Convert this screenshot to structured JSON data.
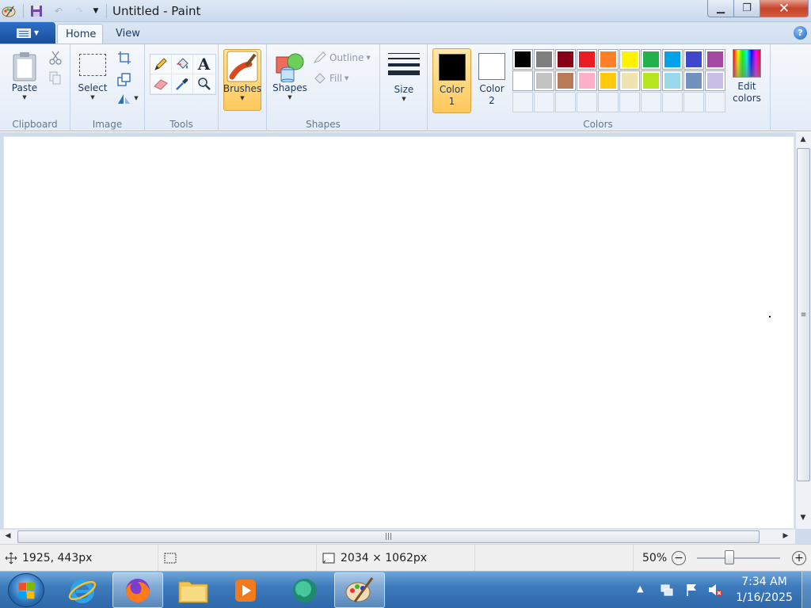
{
  "window": {
    "title": "Untitled - Paint",
    "controls": {
      "minimize": "▁",
      "maximize": "❐",
      "close": "✕"
    }
  },
  "quick_access": {
    "icons": [
      "paint-app-icon",
      "save-icon",
      "undo-icon",
      "redo-icon",
      "customize-arrow-icon"
    ]
  },
  "tabs": [
    {
      "label": "Home",
      "active": true
    },
    {
      "label": "View",
      "active": false
    }
  ],
  "ribbon": {
    "clipboard": {
      "group_label": "Clipboard",
      "paste_label": "Paste"
    },
    "image": {
      "group_label": "Image",
      "select_label": "Select"
    },
    "tools": {
      "group_label": "Tools"
    },
    "brushes": {
      "label": "Brushes"
    },
    "shapes": {
      "group_label": "Shapes",
      "shapes_label": "Shapes",
      "outline_label": "Outline",
      "fill_label": "Fill"
    },
    "size": {
      "label": "Size"
    },
    "colors": {
      "group_label": "Colors",
      "color1_label": "Color\n1",
      "color1_line1": "Color",
      "color1_line2": "1",
      "color2_line1": "Color",
      "color2_line2": "2",
      "color1_value": "#000000",
      "color2_value": "#ffffff",
      "edit_line1": "Edit",
      "edit_line2": "colors",
      "palette_row1": [
        "#000000",
        "#7f7f7f",
        "#880015",
        "#ed1c24",
        "#ff7f27",
        "#fff200",
        "#22b14c",
        "#00a2e8",
        "#3f48cc",
        "#a349a4"
      ],
      "palette_row2": [
        "#ffffff",
        "#c3c3c3",
        "#b97a57",
        "#ffaec9",
        "#ffc90e",
        "#efe4b0",
        "#b5e61d",
        "#99d9ea",
        "#7092be",
        "#c8bfe7"
      ],
      "palette_row3_empty": 10
    }
  },
  "status": {
    "cursor_position": "1925, 443px",
    "selection_size": "",
    "canvas_size": "2034 × 1062px",
    "zoom": "50%",
    "zoom_fraction": 0.5
  },
  "taskbar": {
    "items": [
      "internet-explorer-icon",
      "firefox-icon",
      "file-explorer-icon",
      "media-player-icon",
      "chat-app-icon",
      "paint-app-icon"
    ],
    "active_item": "paint-app-icon",
    "clock_time": "7:34 AM",
    "clock_date": "1/16/2025"
  },
  "colors": {
    "ribbon_highlight": "#ffc85a",
    "file_button": "#1a4e9c",
    "taskbar": "#3d7bbd"
  }
}
